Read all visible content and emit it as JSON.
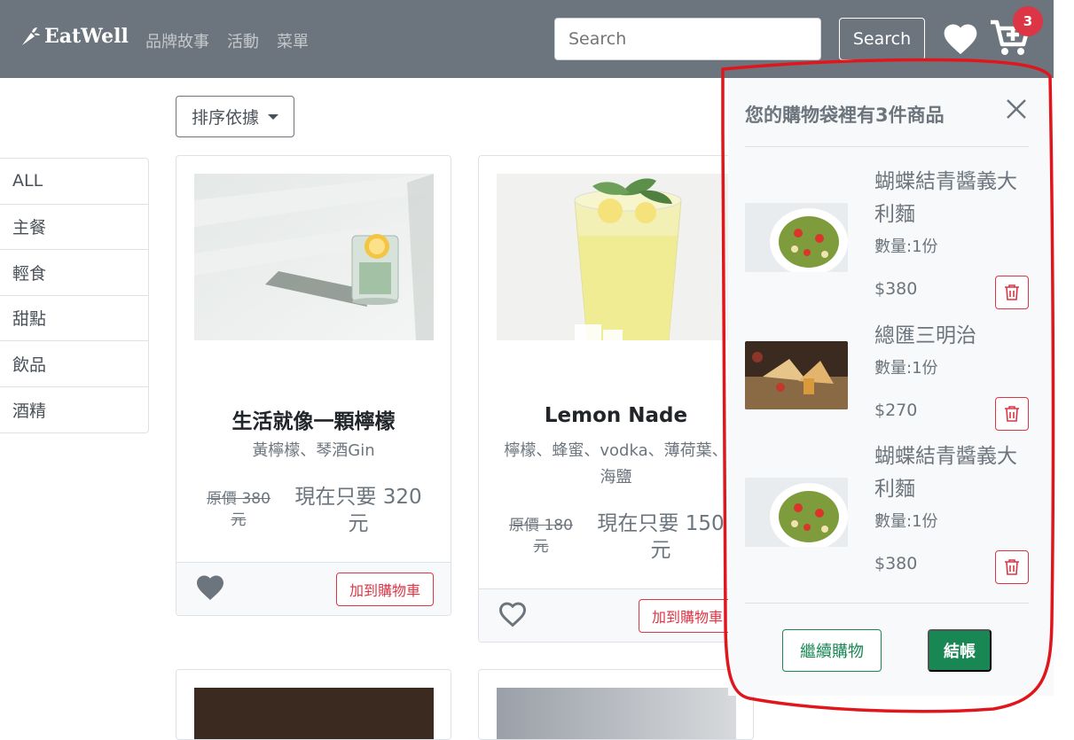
{
  "navbar": {
    "brand": "EatWell",
    "links": [
      "品牌故事",
      "活動",
      "菜單"
    ],
    "search_placeholder": "Search",
    "search_button": "Search",
    "cart_count": "3"
  },
  "sort_button": "排序依據",
  "categories": [
    "ALL",
    "主餐",
    "輕食",
    "甜點",
    "飲品",
    "酒精"
  ],
  "products": [
    {
      "title": "生活就像一顆檸檬",
      "desc": "黃檸檬、琴酒Gin",
      "orig_price": "原價 380 元",
      "now_price": "現在只要 320 元",
      "add_label": "加到購物車",
      "favorited": true
    },
    {
      "title": "Lemon Nade",
      "desc": "檸檬、蜂蜜、vodka、薄荷葉、海鹽",
      "orig_price": "原價 180 元",
      "now_price": "現在只要 150 元",
      "add_label": "加到購物車",
      "favorited": false
    }
  ],
  "cart_panel": {
    "title": "您的購物袋裡有3件商品",
    "items": [
      {
        "name": "蝴蝶結青醬義大利麵",
        "qty": "數量:1份",
        "price": "$380"
      },
      {
        "name": "總匯三明治",
        "qty": "數量:1份",
        "price": "$270"
      },
      {
        "name": "蝴蝶結青醬義大利麵",
        "qty": "數量:1份",
        "price": "$380"
      }
    ],
    "continue_label": "繼續購物",
    "checkout_label": "結帳"
  },
  "colors": {
    "navbar_bg": "#6c757d",
    "danger": "#dc3545",
    "success": "#198754",
    "annotation": "#e0161d"
  }
}
